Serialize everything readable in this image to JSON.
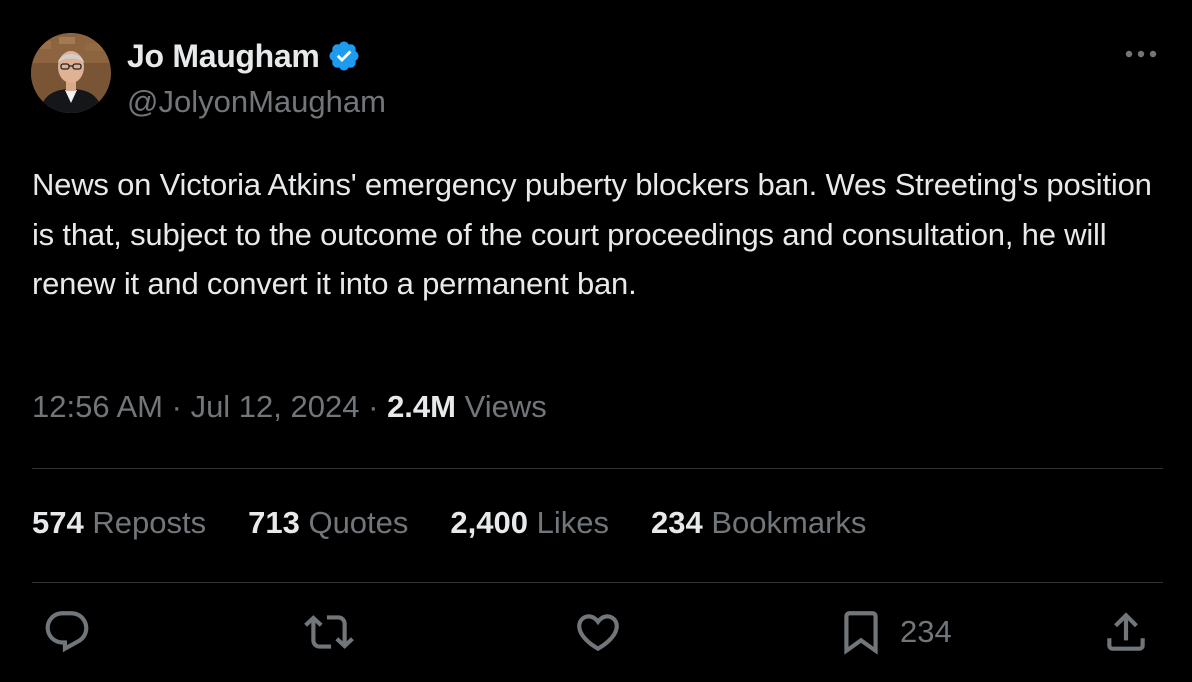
{
  "author": {
    "display_name": "Jo Maugham",
    "handle": "@JolyonMaugham",
    "verified": true,
    "avatar_icon": "profile-photo"
  },
  "tweet": {
    "text": "News on Victoria Atkins' emergency puberty blockers ban. Wes Streeting's position is that, subject to the outcome of the court proceedings and consultation, he will renew it and convert it into a permanent ban.",
    "time": "12:56 AM",
    "date": "Jul 12, 2024",
    "separator": "·",
    "views_count": "2.4M",
    "views_label": "Views"
  },
  "stats": [
    {
      "num": "574",
      "label": "Reposts"
    },
    {
      "num": "713",
      "label": "Quotes"
    },
    {
      "num": "2,400",
      "label": "Likes"
    },
    {
      "num": "234",
      "label": "Bookmarks"
    }
  ],
  "actions": {
    "reply_icon": "reply-icon",
    "repost_icon": "repost-icon",
    "like_icon": "heart-icon",
    "bookmark_icon": "bookmark-icon",
    "bookmark_count": "234",
    "share_icon": "share-icon"
  },
  "colors": {
    "background": "#000000",
    "text_primary": "#e7e9ea",
    "text_secondary": "#71767b",
    "divider": "#2f3336",
    "verified_blue": "#1d9bf0"
  }
}
